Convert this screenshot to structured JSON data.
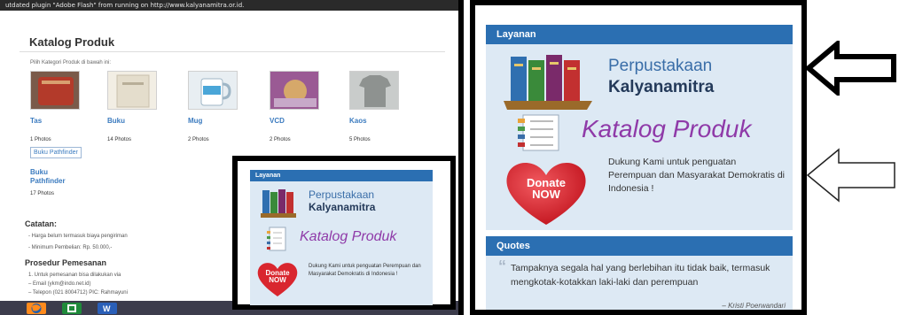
{
  "left_screenshot": {
    "plugin_bar": "utdated plugin \"Adobe Flash\" from running on http://www.kalyanamitra.or.id.",
    "page_title": "Katalog Produk",
    "subtitle": "Pilih Kategori Produk di bawah ini:",
    "categories": [
      {
        "name": "Tas",
        "photos": "1 Photos",
        "thumb_color": "#b33a2a"
      },
      {
        "name": "Buku",
        "photos": "14 Photos",
        "thumb_color": "#e8e2d4"
      },
      {
        "name": "Mug",
        "photos": "2 Photos",
        "thumb_color": "#4aa6d8"
      },
      {
        "name": "VCD",
        "photos": "2 Photos",
        "thumb_color": "#b06a9c"
      },
      {
        "name": "Kaos",
        "photos": "5 Photos",
        "thumb_color": "#a6aaa8"
      }
    ],
    "pathfinder_tag": "Buku Pathfinder",
    "pathfinder_name": "Buku Pathfinder",
    "pathfinder_photos": "17 Photos",
    "catatan_title": "Catatan:",
    "catatan_items": [
      "- Harga belum termasuk biaya pengiriman",
      "- Minimum Pembelian: Rp. 50.000,-"
    ],
    "prosedur_title": "Prosedur Pemesanan",
    "prosedur_items": [
      "1. Untuk pemesanan bisa dilakukan via",
      "   – Email (ykm@indo.net.id)",
      "   – Telepon (021 8004712) PIC: Rahmayuni"
    ],
    "taskbar_icons": [
      "firefox-icon",
      "excel-icon",
      "word-icon"
    ],
    "inset": {
      "header": "Layanan",
      "perpustakaan_line1": "Perpustakaan",
      "perpustakaan_line2": "Kalyanamitra",
      "katalog": "Katalog Produk",
      "donate_line1": "Donate",
      "donate_line2": "NOW",
      "donate_desc": "Dukung Kami untuk penguatan Perempuan dan Masyarakat Demokratis di Indonesia !"
    }
  },
  "right_screenshot": {
    "layanan_header": "Layanan",
    "perpustakaan_line1": "Perpustakaan",
    "perpustakaan_line2": "Kalyanamitra",
    "katalog": "Katalog Produk",
    "donate_line1": "Donate",
    "donate_line2": "NOW",
    "donate_desc": "Dukung Kami untuk penguatan Perempuan dan Masyarakat Demokratis di Indonesia !",
    "quotes_header": "Quotes",
    "quote_text": "Tampaknya segala hal yang berlebihan itu tidak baik, termasuk mengkotak-kotakkan laki-laki dan perempuan",
    "quote_author": "– Kristi Poerwandari"
  },
  "colors": {
    "header_blue": "#2b6fb2",
    "panel_light_blue": "#dde9f4",
    "link_blue": "#3b7bbf",
    "katalog_purple": "#8f3aa8",
    "donate_red": "#d9262e"
  }
}
